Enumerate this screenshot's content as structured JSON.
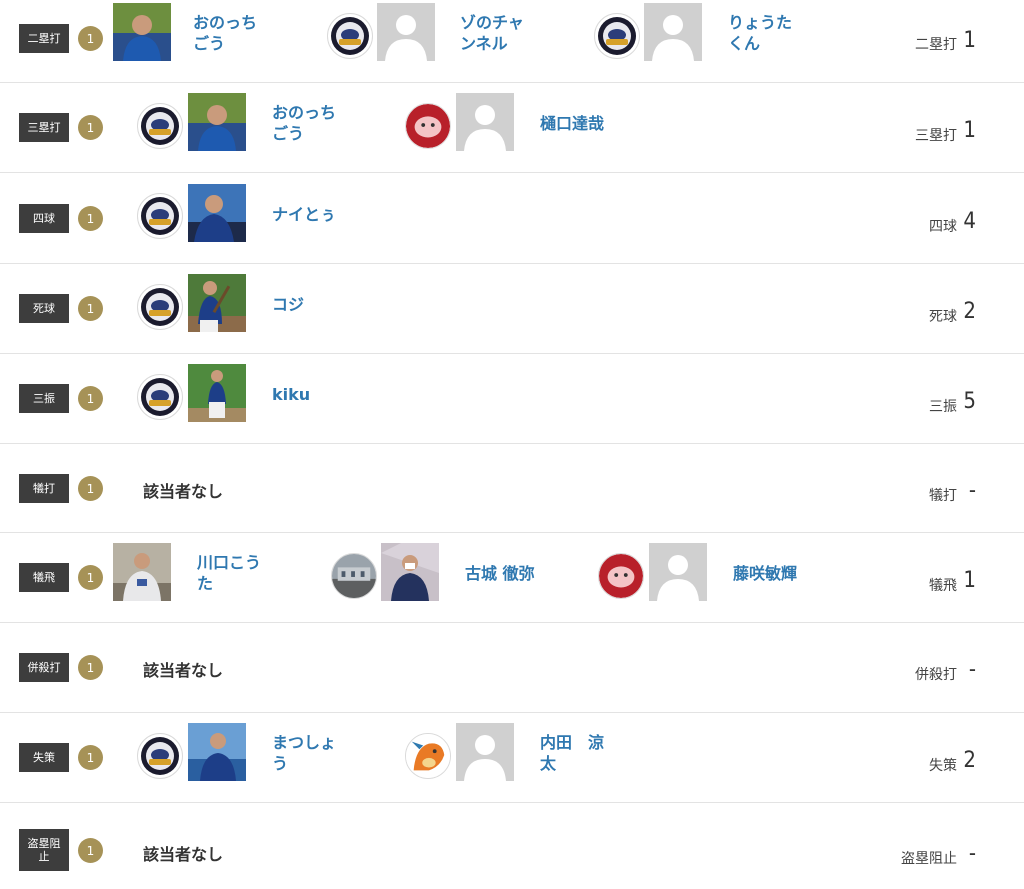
{
  "rows": [
    {
      "category": "二塁打",
      "count": "1",
      "stat_label": "二塁打",
      "stat_value": "1",
      "players": [
        {
          "name_line1": "おのっち",
          "name_line2": "ごう",
          "team_icon": "watchers-logo-icon",
          "photo": "player-photo-blue-uniform"
        },
        {
          "name_line1": "ゾのチャ",
          "name_line2": "ンネル",
          "team_icon": "watchers-logo-icon",
          "photo": "default-avatar-icon"
        },
        {
          "name_line1": "りょうた",
          "name_line2": "くん",
          "team_icon": "watchers-logo-icon",
          "photo": "default-avatar-icon"
        }
      ]
    },
    {
      "category": "三塁打",
      "count": "1",
      "stat_label": "三塁打",
      "stat_value": "1",
      "players": [
        {
          "name_line1": "おのっち",
          "name_line2": "ごう",
          "team_icon": "watchers-logo-icon",
          "photo": "player-photo-blue-uniform"
        },
        {
          "name_line1": "樋口達哉",
          "name_line2": "",
          "team_icon": "pig-team-logo-icon",
          "photo": "default-avatar-icon"
        }
      ]
    },
    {
      "category": "四球",
      "count": "1",
      "stat_label": "四球",
      "stat_value": "4",
      "players": [
        {
          "name_line1": "ナイとぅ",
          "name_line2": "",
          "team_icon": "watchers-logo-icon",
          "photo": "player-photo-blue-uniform"
        }
      ]
    },
    {
      "category": "死球",
      "count": "1",
      "stat_label": "死球",
      "stat_value": "2",
      "players": [
        {
          "name_line1": "コジ",
          "name_line2": "",
          "team_icon": "watchers-logo-icon",
          "photo": "player-photo-batting"
        }
      ]
    },
    {
      "category": "三振",
      "count": "1",
      "stat_label": "三振",
      "stat_value": "5",
      "players": [
        {
          "name_line1": "kiku",
          "name_line2": "",
          "team_icon": "watchers-logo-icon",
          "photo": "player-photo-batting"
        }
      ]
    },
    {
      "category": "犠打",
      "count": "1",
      "stat_label": "犠打",
      "stat_value": "-",
      "none_text": "該当者なし",
      "players": []
    },
    {
      "category": "犠飛",
      "count": "1",
      "stat_label": "犠飛",
      "stat_value": "1",
      "players": [
        {
          "name_line1": "川口こう",
          "name_line2": "た",
          "team_icon": "",
          "photo": "player-photo-white-hoodie"
        },
        {
          "name_line1": "古城 徹弥",
          "name_line2": "",
          "team_icon": "street-photo-icon",
          "photo": "player-photo-navy-uniform"
        },
        {
          "name_line1": "藤咲敏輝",
          "name_line2": "",
          "team_icon": "pig-team-logo-icon",
          "photo": "default-avatar-icon"
        }
      ]
    },
    {
      "category": "併殺打",
      "count": "1",
      "stat_label": "併殺打",
      "stat_value": "-",
      "none_text": "該当者なし",
      "players": []
    },
    {
      "category": "失策",
      "count": "1",
      "stat_label": "失策",
      "stat_value": "2",
      "players": [
        {
          "name_line1": "まつしょ",
          "name_line2": "う",
          "team_icon": "watchers-logo-icon",
          "photo": "player-photo-blue-uniform"
        },
        {
          "name_line1": "内田　涼",
          "name_line2": "太",
          "team_icon": "dragon-logo-icon",
          "photo": "default-avatar-icon"
        }
      ]
    },
    {
      "category": "盗塁阻止",
      "count": "1",
      "stat_label": "盗塁阻止",
      "stat_value": "-",
      "none_text": "該当者なし",
      "players": []
    }
  ]
}
